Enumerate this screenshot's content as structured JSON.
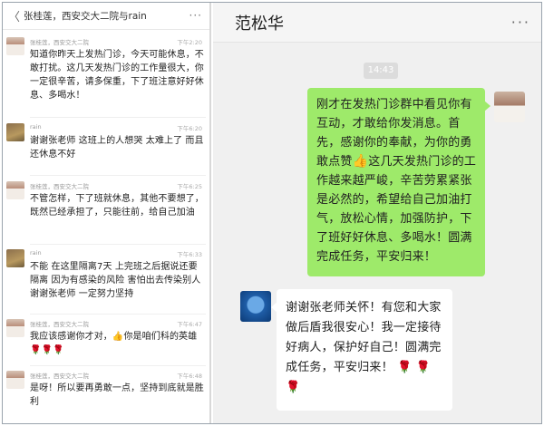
{
  "left": {
    "header_back": "〈",
    "header_title": "张桂莲，西安交大二院与rain",
    "header_more": "···",
    "messages": [
      {
        "name": "张桂莲，西安交大二院",
        "time": "下午2:20",
        "avatar": "woman-avatar",
        "text": "知道你昨天上发热门诊，今天可能休息，不敢打扰。这几天发热门诊的工作量很大，你一定很辛苦，请多保重，下了班注意好好休息、多喝水！"
      },
      {
        "name": "rain",
        "time": "下午6:20",
        "avatar": "rain-avatar",
        "text": "谢谢张老师 这班上的人想哭 太难上了 而且还休息不好"
      },
      {
        "name": "张桂莲，西安交大二院",
        "time": "下午6:25",
        "avatar": "woman-avatar",
        "text": "不管怎样，下了班就休息，其他不要想了，既然已经承担了，只能往前，给自己加油"
      },
      {
        "name": "rain",
        "time": "下午6:33",
        "avatar": "rain-avatar",
        "text": "不能 在这里隔离7天 上完班之后据说还要隔离 因为有感染的风险 害怕出去传染别人谢谢张老师 一定努力坚持"
      },
      {
        "name": "张桂莲，西安交大二院",
        "time": "下午6:47",
        "avatar": "woman-avatar",
        "text": "我应该感谢你才对，👍你是咱们科的英雄🌹🌹🌹"
      },
      {
        "name": "张桂莲，西安交大二院",
        "time": "下午6:48",
        "avatar": "woman-avatar",
        "text": "是呀！所以要再勇敢一点，坚持到底就是胜利"
      }
    ]
  },
  "right": {
    "title": "范松华",
    "more": "···",
    "timestamp": "14:43",
    "sent_message": {
      "part1": "刚才在发热门诊群中看见你有互动，才敢给你发消息。首先，感谢你的奉献，为你的勇敢点赞",
      "emoji": "👍",
      "part2": "这几天发热门诊的工作越来越严峻，辛苦劳累紧张是必然的，希望给自己加油打气，放松心情，加强防护，下了班好好休息、多喝水！圆满完成任务，平安归来！"
    },
    "received_message": {
      "text": "谢谢张老师关怀！有您和大家做后盾我很安心！我一定接待好病人，保护好自己！圆满完成任务，平安归来！",
      "roses": "🌹 🌹 🌹"
    }
  }
}
